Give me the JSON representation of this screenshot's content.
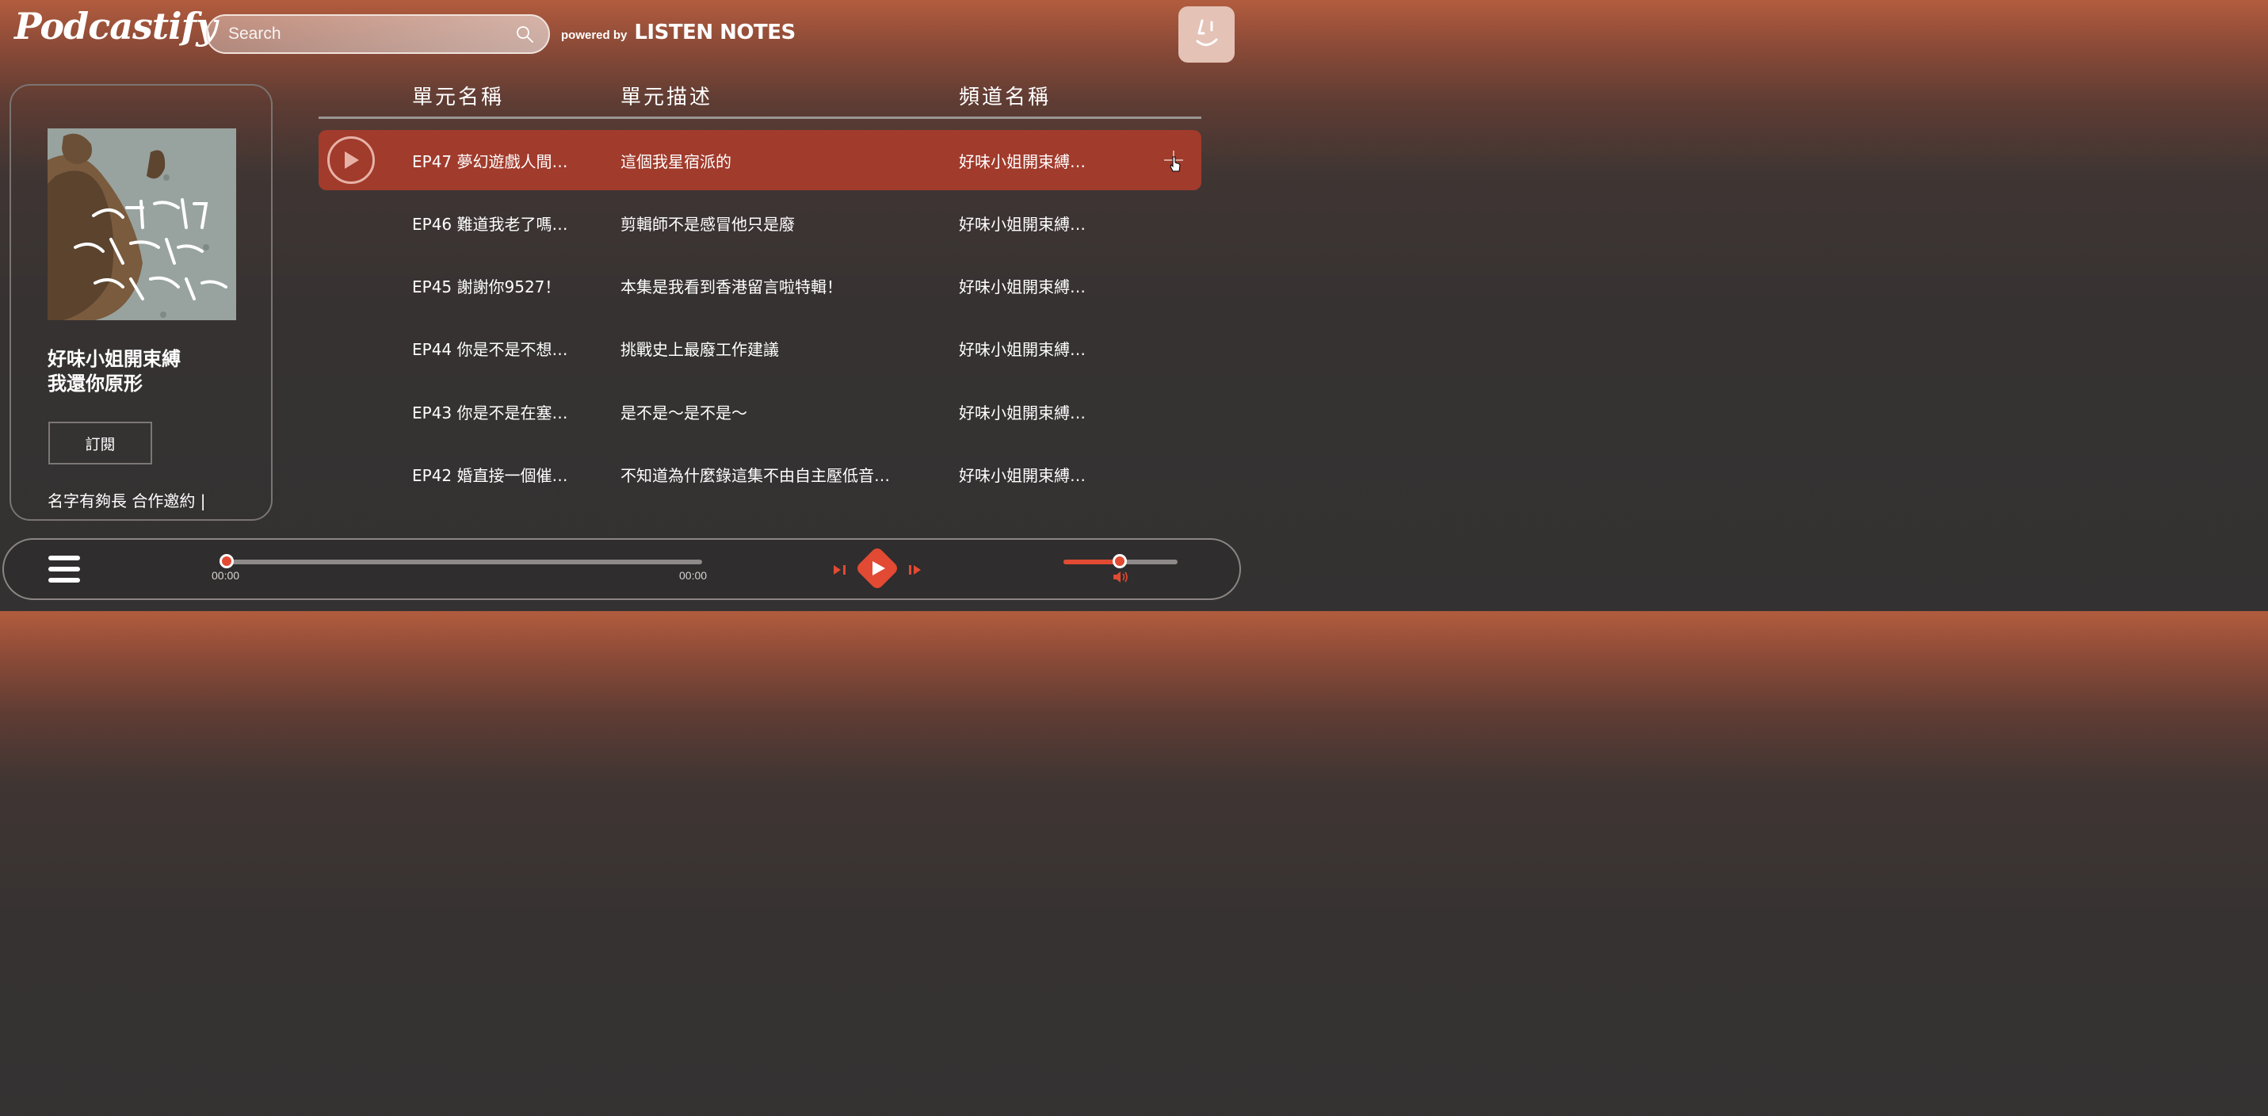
{
  "header": {
    "logo": "Podcastify",
    "search_placeholder": "Search",
    "powered_by_small": "powered by",
    "powered_by_brand": "LISTEN NOTES"
  },
  "sidebar_card": {
    "title_line1": "好味小姐開束縛",
    "title_line2": "我還你原形",
    "subscribe_label": "訂閱",
    "description": "名字有夠長 合作邀約 |"
  },
  "table": {
    "headers": [
      "單元名稱",
      "單元描述",
      "頻道名稱"
    ],
    "rows": [
      {
        "name": "EP47 夢幻遊戲人間…",
        "desc": "這個我星宿派的",
        "channel": "好味小姐開束縛…"
      },
      {
        "name": "EP46 難道我老了嗎…",
        "desc": "剪輯師不是感冒他只是廢",
        "channel": "好味小姐開束縛…"
      },
      {
        "name": "EP45 謝謝你9527！",
        "desc": "本集是我看到香港留言啦特輯！",
        "channel": "好味小姐開束縛…"
      },
      {
        "name": "EP44 你是不是不想…",
        "desc": "挑戰史上最廢工作建議",
        "channel": "好味小姐開束縛…"
      },
      {
        "name": "EP43 你是不是在塞…",
        "desc": "是不是～是不是～",
        "channel": "好味小姐開束縛…"
      },
      {
        "name": "EP42 婚直接一個催…",
        "desc": "不知道為什麼錄這集不由自主壓低音…",
        "channel": "好味小姐開束縛…"
      }
    ]
  },
  "player": {
    "current_time": "00:00",
    "total_time": "00:00",
    "progress_fraction": 0,
    "volume_fraction": 0.5
  },
  "colors": {
    "accent": "#e24a33",
    "active_row": "#a13b2c"
  },
  "icons": [
    "search-icon",
    "avatar-face-icon",
    "play-icon",
    "add-icon",
    "cursor-hand-icon",
    "menu-icon",
    "prev-icon",
    "next-icon",
    "volume-icon"
  ]
}
